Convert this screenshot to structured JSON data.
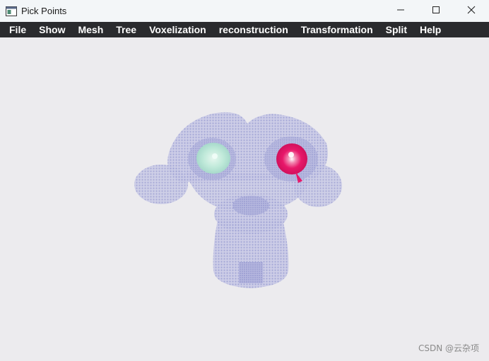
{
  "window": {
    "title": "Pick Points"
  },
  "menu": {
    "items": [
      {
        "label": "File"
      },
      {
        "label": "Show"
      },
      {
        "label": "Mesh"
      },
      {
        "label": "Tree"
      },
      {
        "label": "Voxelization"
      },
      {
        "label": "reconstruction"
      },
      {
        "label": "Transformation"
      },
      {
        "label": "Split"
      },
      {
        "label": "Help"
      }
    ]
  },
  "viewport": {
    "model_color": "#a6a9d8",
    "picked_point_colors": [
      "#b5e8d6",
      "#e8186a"
    ]
  },
  "watermark": "CSDN @云杂项",
  "icons": {
    "app": "app-window-icon",
    "minimize": "minimize-icon",
    "maximize": "maximize-icon",
    "close": "close-icon"
  }
}
